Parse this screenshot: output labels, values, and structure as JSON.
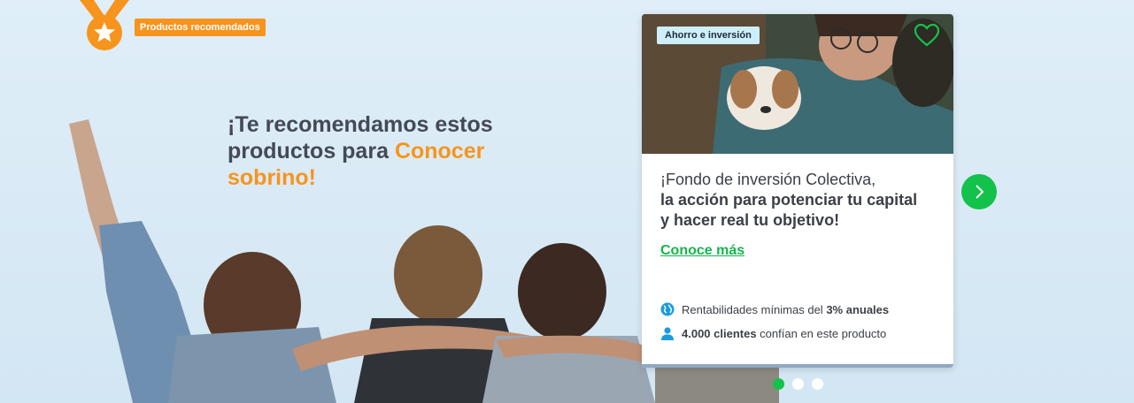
{
  "badge": {
    "label": "Productos recomendados",
    "icon": "medal-star-icon",
    "color": "#f7941d"
  },
  "headline": {
    "part1": "¡Te recomendamos estos productos para",
    "highlight": "Conocer sobrino!",
    "accent_color": "#f7941d"
  },
  "card": {
    "category_tag": "Ahorro e inversión",
    "favorite_icon": "heart-outline-icon",
    "title_regular": "¡Fondo de inversión Colectiva,",
    "title_bold": "la acción para potenciar tu capital y hacer real tu objetivo!",
    "link_label": "Conoce más",
    "features": [
      {
        "icon": "globe-icon",
        "pre": "Rentabilidades mínimas del ",
        "bold": "3% anuales",
        "post": ""
      },
      {
        "icon": "user-icon",
        "pre": "",
        "bold": "4.000 clientes",
        "post": " confían en este producto"
      }
    ]
  },
  "carousel": {
    "next_icon": "chevron-right-icon",
    "dots": 3,
    "active_dot": 1,
    "accent_color": "#13c24b"
  }
}
